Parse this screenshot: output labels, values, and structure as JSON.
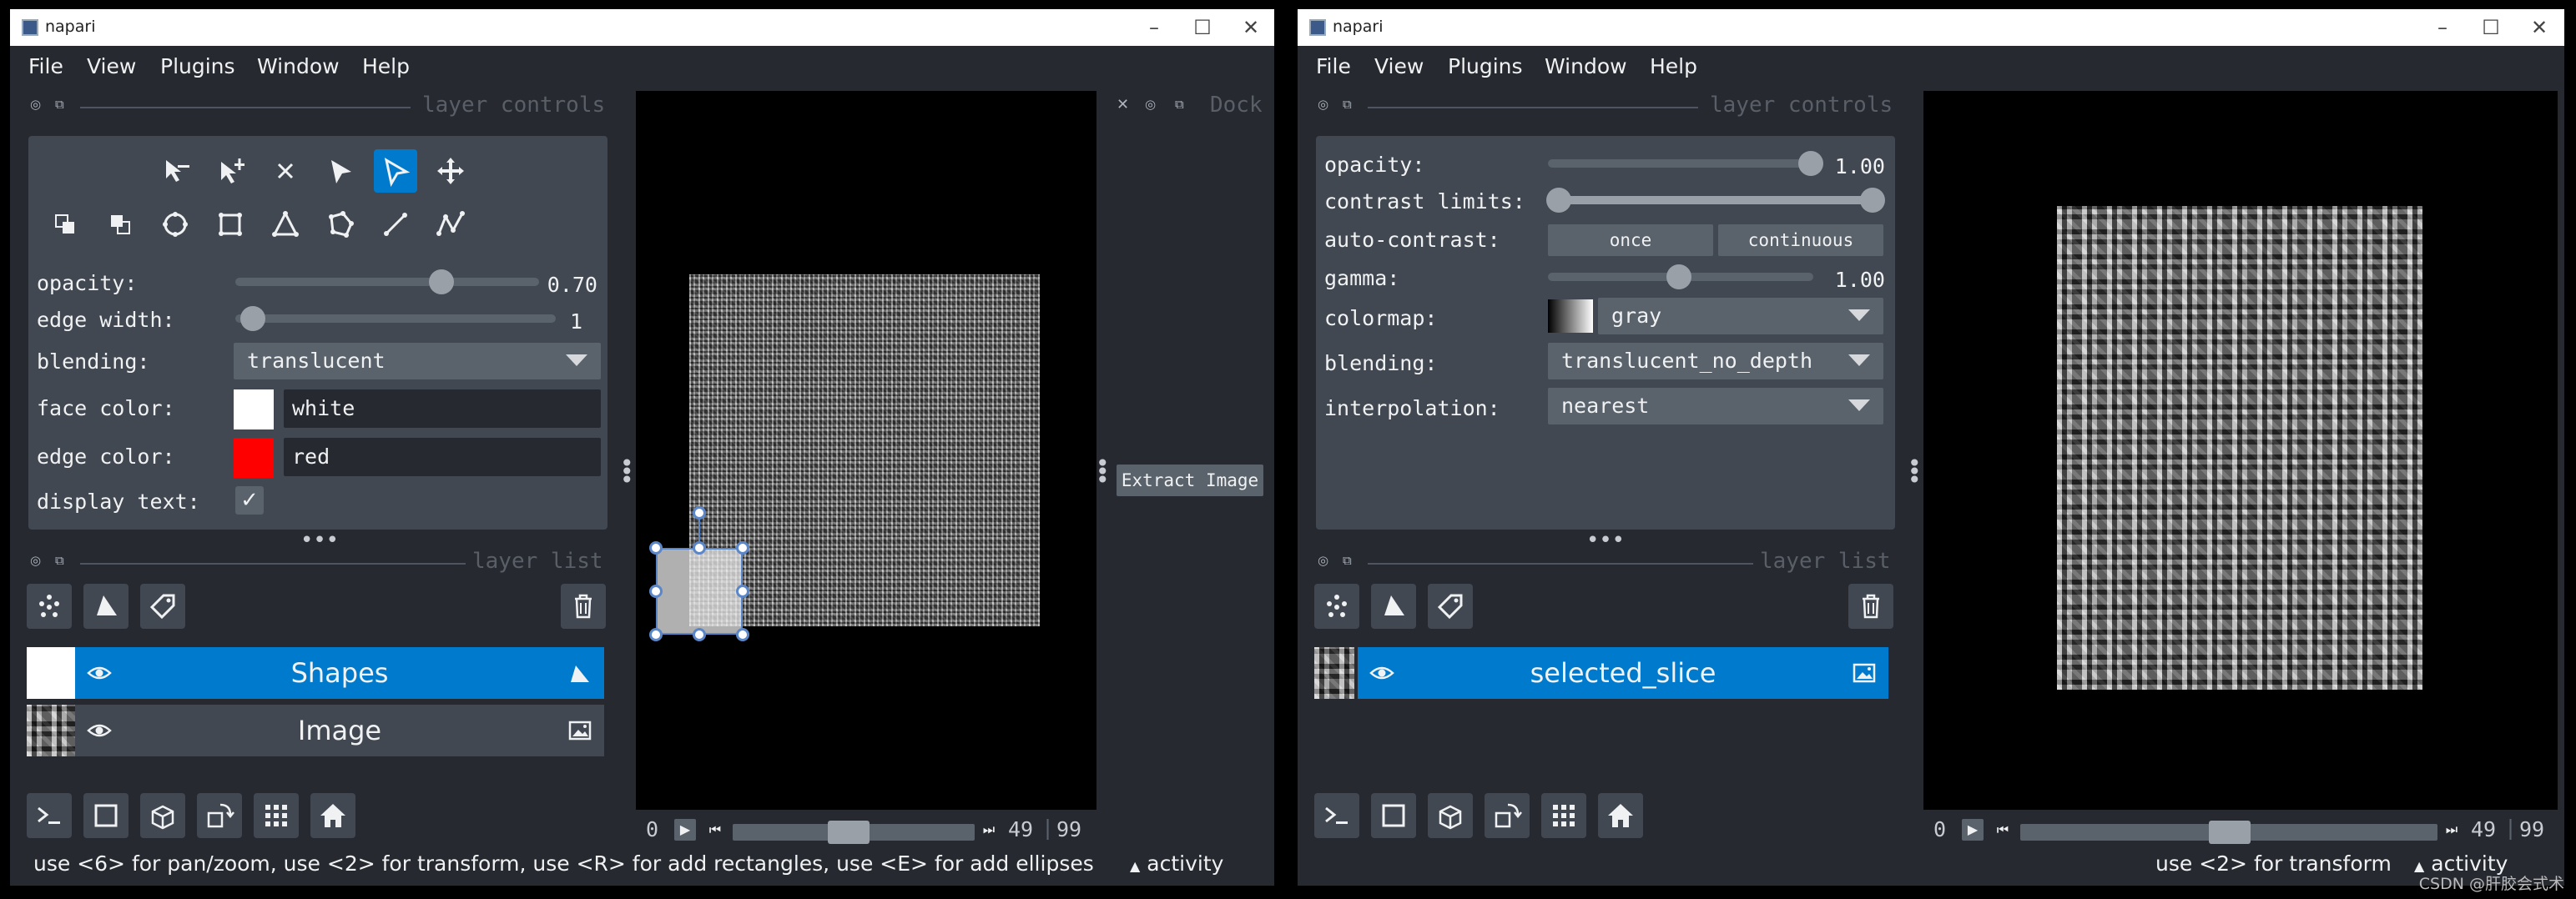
{
  "left_window": {
    "title": "napari",
    "menu": [
      "File",
      "View",
      "Plugins",
      "Window",
      "Help"
    ],
    "layer_controls_header": "layer controls",
    "dock_header": "Dock",
    "controls": {
      "opacity_label": "opacity:",
      "opacity_value": "0.70",
      "opacity_level": 0.7,
      "edge_width_label": "edge width:",
      "edge_width_value": "1",
      "blending_label": "blending:",
      "blending_value": "translucent",
      "face_color_label": "face color:",
      "face_color_value": "white",
      "face_color": "#ffffff",
      "edge_color_label": "edge color:",
      "edge_color_value": "red",
      "edge_color": "#ff0000",
      "display_text_label": "display text:",
      "display_text_checked": true
    },
    "layer_list_header": "layer list",
    "layers": [
      {
        "name": "Shapes",
        "selected": true
      },
      {
        "name": "Image",
        "selected": false
      }
    ],
    "dock_button": "Extract Image",
    "dims": {
      "start": "0",
      "current": "49",
      "max": "99",
      "position": 0.49
    },
    "status": "use <6> for pan/zoom, use <2> for transform, use <R> for add rectangles, use <E> for add ellipses, use <L...",
    "activity": "activity"
  },
  "right_window": {
    "title": "napari",
    "menu": [
      "File",
      "View",
      "Plugins",
      "Window",
      "Help"
    ],
    "layer_controls_header": "layer controls",
    "controls": {
      "opacity_label": "opacity:",
      "opacity_value": "1.00",
      "opacity_level": 1.0,
      "contrast_label": "contrast limits:",
      "autocontrast_label": "auto-contrast:",
      "once_button": "once",
      "continuous_button": "continuous",
      "gamma_label": "gamma:",
      "gamma_value": "1.00",
      "colormap_label": "colormap:",
      "colormap_value": "gray",
      "blending_label": "blending:",
      "blending_value": "translucent_no_depth",
      "interpolation_label": "interpolation:",
      "interpolation_value": "nearest"
    },
    "layer_list_header": "layer list",
    "layers": [
      {
        "name": "selected_slice",
        "selected": true
      }
    ],
    "dims": {
      "start": "0",
      "current": "49",
      "max": "99",
      "position": 0.49
    },
    "status": "use <2> for transform",
    "activity": "activity"
  },
  "watermark": "CSDN @肝胶会式术",
  "colors": {
    "accent": "#007acc",
    "background": "#262930",
    "panel": "#414851"
  }
}
